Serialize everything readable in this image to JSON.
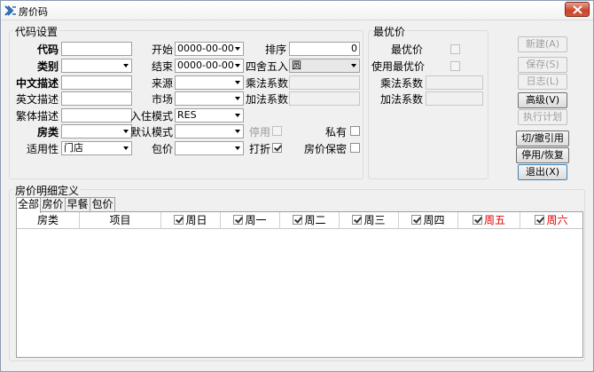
{
  "window": {
    "title": "房价码"
  },
  "code_settings": {
    "legend": "代码设置",
    "code_label": "代码",
    "code_value": "",
    "category_label": "类别",
    "category_value": "",
    "cn_desc_label": "中文描述",
    "cn_desc_value": "",
    "en_desc_label": "英文描述",
    "en_desc_value": "",
    "tc_desc_label": "繁体描述",
    "tc_desc_value": "",
    "room_type_label": "房类",
    "room_type_value": "",
    "applicability_label": "适用性",
    "applicability_value": "门店",
    "start_label": "开始",
    "start_value": "0000-00-00",
    "end_label": "结束",
    "end_value": "0000-00-00",
    "source_label": "来源",
    "source_value": "",
    "market_label": "市场",
    "market_value": "",
    "checkin_mode_label": "入住模式",
    "checkin_mode_value": "RES",
    "default_mode_label": "默认模式",
    "default_mode_value": "",
    "package_label": "包价",
    "package_value": "",
    "sort_label": "排序",
    "sort_value": "0",
    "rounding_label": "四舍五入",
    "rounding_value": "圆",
    "mult_coef_label": "乘法系数",
    "mult_coef_value": "",
    "add_coef_label": "加法系数",
    "add_coef_value": "",
    "disabled_label": "停用",
    "disabled_checked": false,
    "discount_label": "打折",
    "discount_checked": true,
    "private_label": "私有",
    "private_checked": false,
    "price_secret_label": "房价保密",
    "price_secret_checked": false
  },
  "best_price": {
    "legend": "最优价",
    "best_price_label": "最优价",
    "best_price_checked": false,
    "use_best_label": "使用最优价",
    "use_best_checked": false,
    "mult_coef_label": "乘法系数",
    "mult_coef_value": "",
    "add_coef_label": "加法系数",
    "add_coef_value": ""
  },
  "buttons": {
    "new": "新建(A)",
    "save": "保存(S)",
    "log": "日志(L)",
    "advanced": "高级(V)",
    "exec_plan": "执行计划",
    "cut_ref": "切/撤引用",
    "disable_restore": "停用/恢复",
    "exit": "退出(X)"
  },
  "detail": {
    "legend": "房价明细定义",
    "tabs": [
      "全部",
      "房价",
      "早餐",
      "包价"
    ],
    "columns": {
      "room_type": "房类",
      "item": "项目",
      "days": [
        "周日",
        "周一",
        "周二",
        "周三",
        "周四",
        "周五",
        "周六"
      ]
    },
    "weekend_color": "#e00000"
  }
}
